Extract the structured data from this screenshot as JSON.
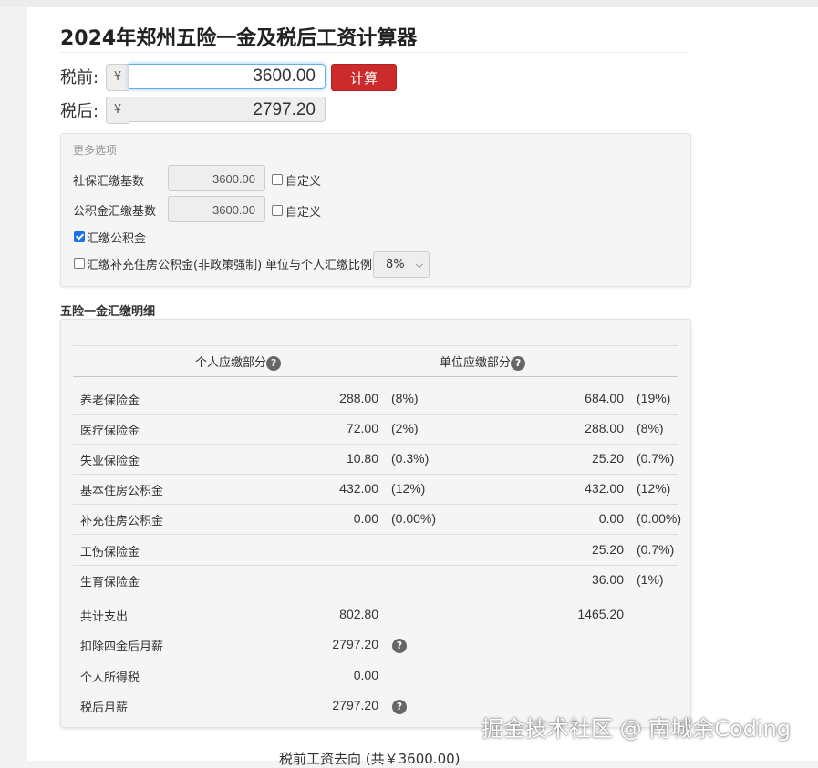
{
  "page": {
    "title": "2024年郑州五险一金及税后工资计算器"
  },
  "salary": {
    "pre_label": "税前:",
    "post_label": "税后:",
    "currency": "¥",
    "pre_value": "3600.00",
    "post_value": "2797.20",
    "calc_button": "计算"
  },
  "options": {
    "legend": "更多选项",
    "social_base_label": "社保汇缴基数",
    "social_base_value": "3600.00",
    "fund_base_label": "公积金汇缴基数",
    "fund_base_value": "3600.00",
    "custom_label": "自定义",
    "pay_fund_label": "汇缴公积金",
    "pay_fund_checked": true,
    "pay_supplement_label": "汇缴补充住房公积金(非政策强制)",
    "pay_supplement_checked": false,
    "ratio_label": "单位与个人汇缴比例",
    "ratio_value": "8%"
  },
  "details": {
    "title": "五险一金汇缴明细",
    "header_personal": "个人应缴部分",
    "header_company": "单位应缴部分",
    "help_glyph": "?",
    "rows": [
      {
        "name": "养老保险金",
        "personal": "288.00",
        "personal_rate": "(8%)",
        "company": "684.00",
        "company_rate": "(19%)"
      },
      {
        "name": "医疗保险金",
        "personal": "72.00",
        "personal_rate": "(2%)",
        "company": "288.00",
        "company_rate": "(8%)"
      },
      {
        "name": "失业保险金",
        "personal": "10.80",
        "personal_rate": "(0.3%)",
        "company": "25.20",
        "company_rate": "(0.7%)"
      },
      {
        "name": "基本住房公积金",
        "personal": "432.00",
        "personal_rate": "(12%)",
        "company": "432.00",
        "company_rate": "(12%)"
      },
      {
        "name": "补充住房公积金",
        "personal": "0.00",
        "personal_rate": "(0.00%)",
        "company": "0.00",
        "company_rate": "(0.00%)"
      },
      {
        "name": "工伤保险金",
        "personal": "",
        "personal_rate": "",
        "company": "25.20",
        "company_rate": "(0.7%)"
      },
      {
        "name": "生育保险金",
        "personal": "",
        "personal_rate": "",
        "company": "36.00",
        "company_rate": "(1%)"
      }
    ],
    "total_label": "共计支出",
    "total_personal": "802.80",
    "total_company": "1465.20",
    "after_deduct_label": "扣除四金后月薪",
    "after_deduct_value": "2797.20",
    "income_tax_label": "个人所得税",
    "income_tax_value": "0.00",
    "net_label": "税后月薪",
    "net_value": "2797.20"
  },
  "footer": {
    "flow_title": "税前工资去向 (共￥3600.00)",
    "watermark": "掘金技术社区 @ 南城余Coding"
  },
  "colors": {
    "accent_red": "#cc2b2b",
    "focus_blue": "#66afe9",
    "checkbox_blue": "#1a73e8",
    "help_icon_gray": "#666666"
  }
}
